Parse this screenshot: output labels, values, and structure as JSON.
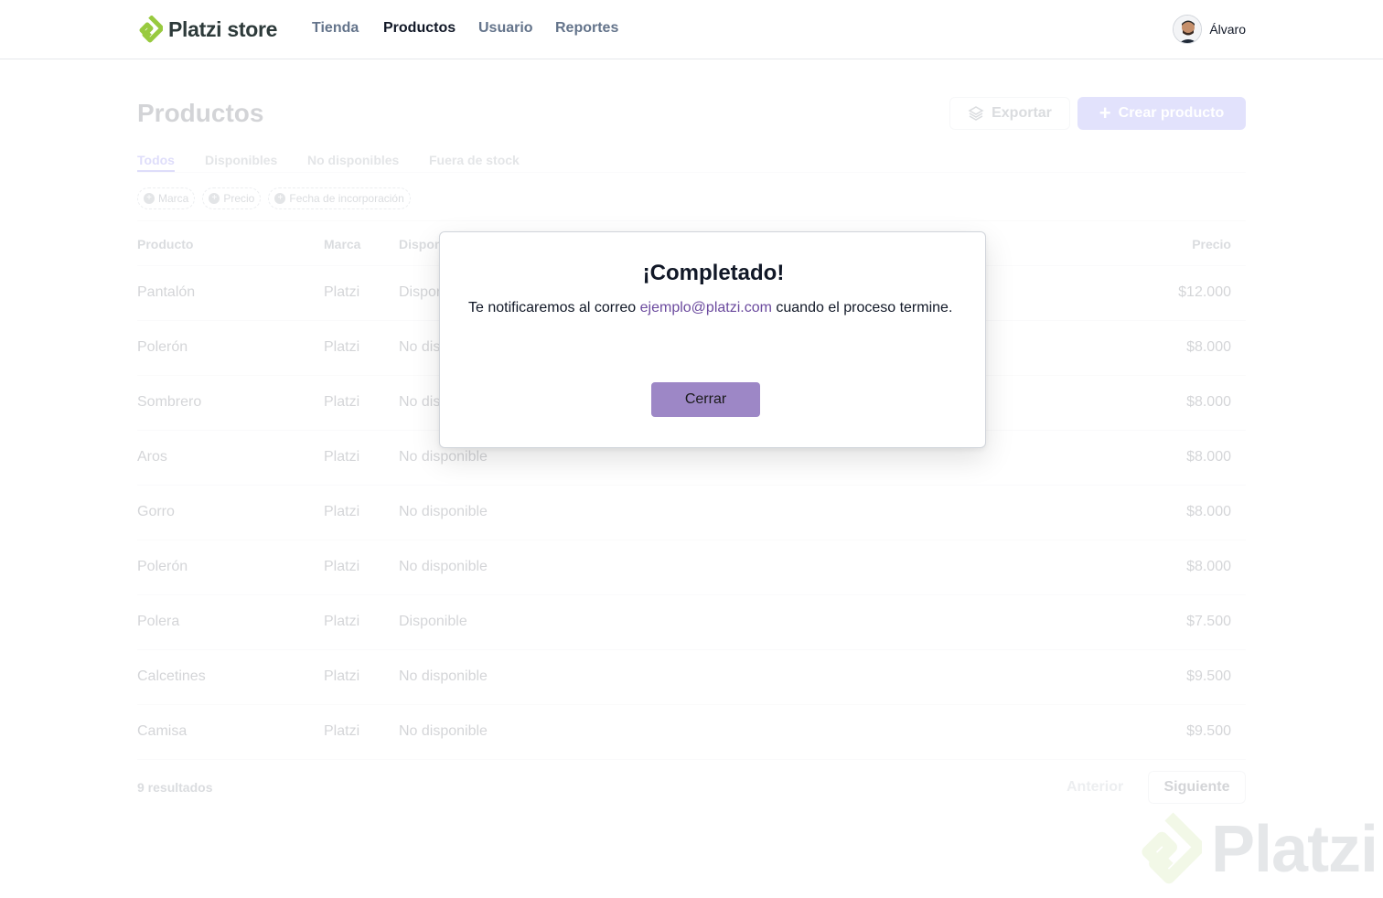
{
  "navbar": {
    "logo_text": "Platzi store",
    "links": [
      {
        "label": "Tienda",
        "active": false
      },
      {
        "label": "Productos",
        "active": true
      },
      {
        "label": "Usuario",
        "active": false
      },
      {
        "label": "Reportes",
        "active": false
      }
    ],
    "user_name": "Álvaro"
  },
  "page": {
    "title": "Productos",
    "export_label": "Exportar",
    "create_label": "Crear producto",
    "tabs": [
      "Todos",
      "Disponibles",
      "No disponibles",
      "Fuera de stock"
    ],
    "filters": [
      "Marca",
      "Precio",
      "Fecha de incorporación"
    ],
    "table": {
      "headers": [
        "Producto",
        "Marca",
        "Disponibilidad",
        "Precio"
      ],
      "rows": [
        {
          "product": "Pantalón",
          "brand": "Platzi",
          "availability": "Disponible",
          "price": "$12.000"
        },
        {
          "product": "Polerón",
          "brand": "Platzi",
          "availability": "No disponible",
          "price": "$8.000"
        },
        {
          "product": "Sombrero",
          "brand": "Platzi",
          "availability": "No disponible",
          "price": "$8.000"
        },
        {
          "product": "Aros",
          "brand": "Platzi",
          "availability": "No disponible",
          "price": "$8.000"
        },
        {
          "product": "Gorro",
          "brand": "Platzi",
          "availability": "No disponible",
          "price": "$8.000"
        },
        {
          "product": "Polerón",
          "brand": "Platzi",
          "availability": "No disponible",
          "price": "$8.000"
        },
        {
          "product": "Polera",
          "brand": "Platzi",
          "availability": "Disponible",
          "price": "$7.500"
        },
        {
          "product": "Calcetines",
          "brand": "Platzi",
          "availability": "No disponible",
          "price": "$9.500"
        },
        {
          "product": "Camisa",
          "brand": "Platzi",
          "availability": "No disponible",
          "price": "$9.500"
        }
      ]
    },
    "results": "9 resultados",
    "prev_label": "Anterior",
    "next_label": "Siguiente"
  },
  "modal": {
    "title": "¡Completado!",
    "message_before": "Te notificaremos al correo ",
    "email": "ejemplo@platzi.com",
    "message_after": " cuando el proceso termine.",
    "close_label": "Cerrar"
  },
  "watermark": "Platzi",
  "colors": {
    "brand_green": "#98ca3f",
    "modal_button": "#9d87c6",
    "email_link": "#6b4a9e"
  }
}
